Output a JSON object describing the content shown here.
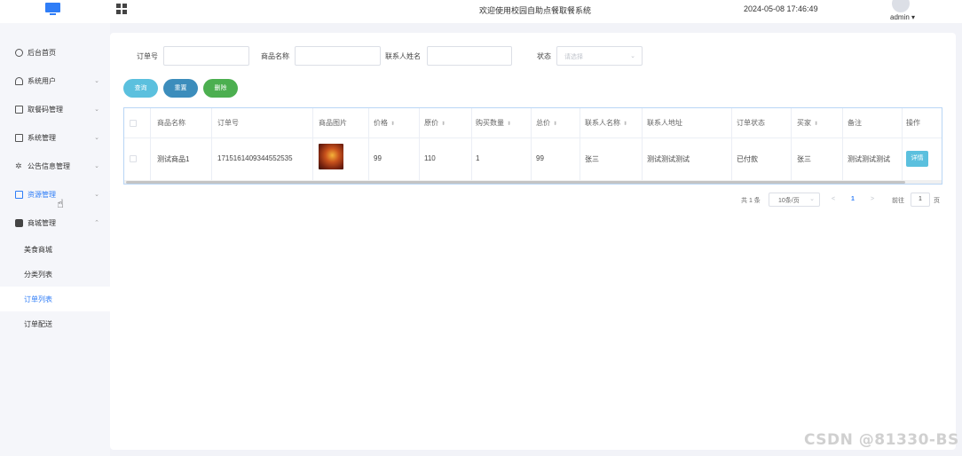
{
  "header": {
    "title": "欢迎使用校园自助点餐取餐系统",
    "datetime": "2024-05-08 17:46:49",
    "user": "admin",
    "logo_icon": "monitor-icon",
    "menu_toggle_icon": "grid-icon"
  },
  "sidebar": {
    "items": [
      {
        "label": "后台首页",
        "icon": "clock-icon"
      },
      {
        "label": "系统用户",
        "icon": "user-icon"
      },
      {
        "label": "取餐码管理",
        "icon": "inbox-icon"
      },
      {
        "label": "系统管理",
        "icon": "mail-icon"
      },
      {
        "label": "公告信息管理",
        "icon": "sparkle-icon"
      },
      {
        "label": "资源管理",
        "icon": "monitor-icon"
      },
      {
        "label": "商城管理",
        "icon": "shop-icon"
      }
    ],
    "sub_items": [
      {
        "label": "美食商城"
      },
      {
        "label": "分类列表"
      },
      {
        "label": "订单列表",
        "active": true
      },
      {
        "label": "订单配送"
      }
    ]
  },
  "filters": {
    "order_no_label": "订单号",
    "product_name_label": "商品名称",
    "contact_name_label": "联系人姓名",
    "status_label": "状态",
    "status_placeholder": "请选择"
  },
  "buttons": {
    "query": "查询",
    "reset": "重置",
    "delete": "删除"
  },
  "colors": {
    "query": "#5bc0de",
    "reset": "#3c8dbc",
    "delete": "#4caf50",
    "accent": "#2f7df7"
  },
  "table": {
    "columns": [
      "商品名称",
      "订单号",
      "商品图片",
      "价格",
      "原价",
      "购买数量",
      "总价",
      "联系人名称",
      "联系人地址",
      "订单状态",
      "买家",
      "备注",
      "操作"
    ],
    "rows": [
      {
        "product_name": "测试商品1",
        "order_no": "1715161409344552535",
        "price": "99",
        "original_price": "110",
        "quantity": "1",
        "total": "99",
        "contact_name": "张三",
        "contact_address": "测试测试测试",
        "status": "已付款",
        "buyer": "张三",
        "remark": "测试测试测试",
        "action": "详情"
      }
    ]
  },
  "pagination": {
    "total": "共 1 条",
    "page_size": "10条/页",
    "current": "1",
    "goto_label": "前往",
    "goto_value": "1",
    "page_suffix": "页"
  },
  "watermark": "CSDN @81330-BS"
}
